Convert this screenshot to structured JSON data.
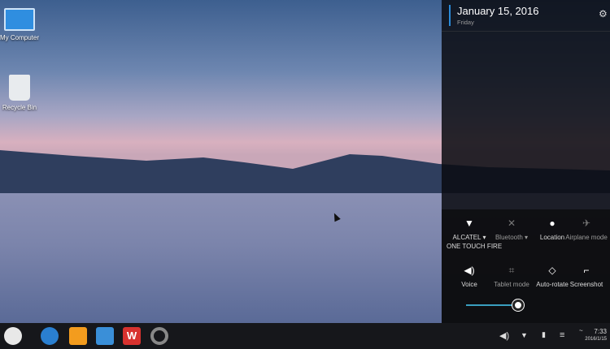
{
  "desktop": {
    "icons": [
      {
        "label": "My Computer",
        "icon": "computer-icon"
      },
      {
        "label": "Recycle Bin",
        "icon": "recycle-bin-icon"
      }
    ]
  },
  "panel": {
    "date": "January 15, 2016",
    "weekday": "Friday",
    "tiles": [
      {
        "label": "ALCATEL",
        "sub": "ONE TOUCH FIRE",
        "icon": "wifi-icon",
        "active": true,
        "dropdown": true
      },
      {
        "label": "Bluetooth",
        "icon": "bluetooth-off-icon",
        "active": false,
        "dropdown": true
      },
      {
        "label": "Location",
        "icon": "location-icon",
        "active": true
      },
      {
        "label": "Airplane mode",
        "icon": "airplane-icon",
        "active": false
      },
      {
        "label": "Voice",
        "icon": "volume-icon",
        "active": true
      },
      {
        "label": "Tablet mode",
        "icon": "tablet-mode-icon",
        "active": false
      },
      {
        "label": "Auto-rotate",
        "icon": "auto-rotate-icon",
        "active": true
      },
      {
        "label": "Screenshot",
        "icon": "crop-icon",
        "active": true
      }
    ],
    "brightness": 0.88,
    "accent": "#3a9fc0"
  },
  "taskbar": {
    "time": "7:33",
    "date": "2016/1/15",
    "apps": [
      "start-icon",
      "browser-icon",
      "files-icon",
      "mail-icon",
      "wps-office-icon",
      "settings-icon"
    ]
  }
}
